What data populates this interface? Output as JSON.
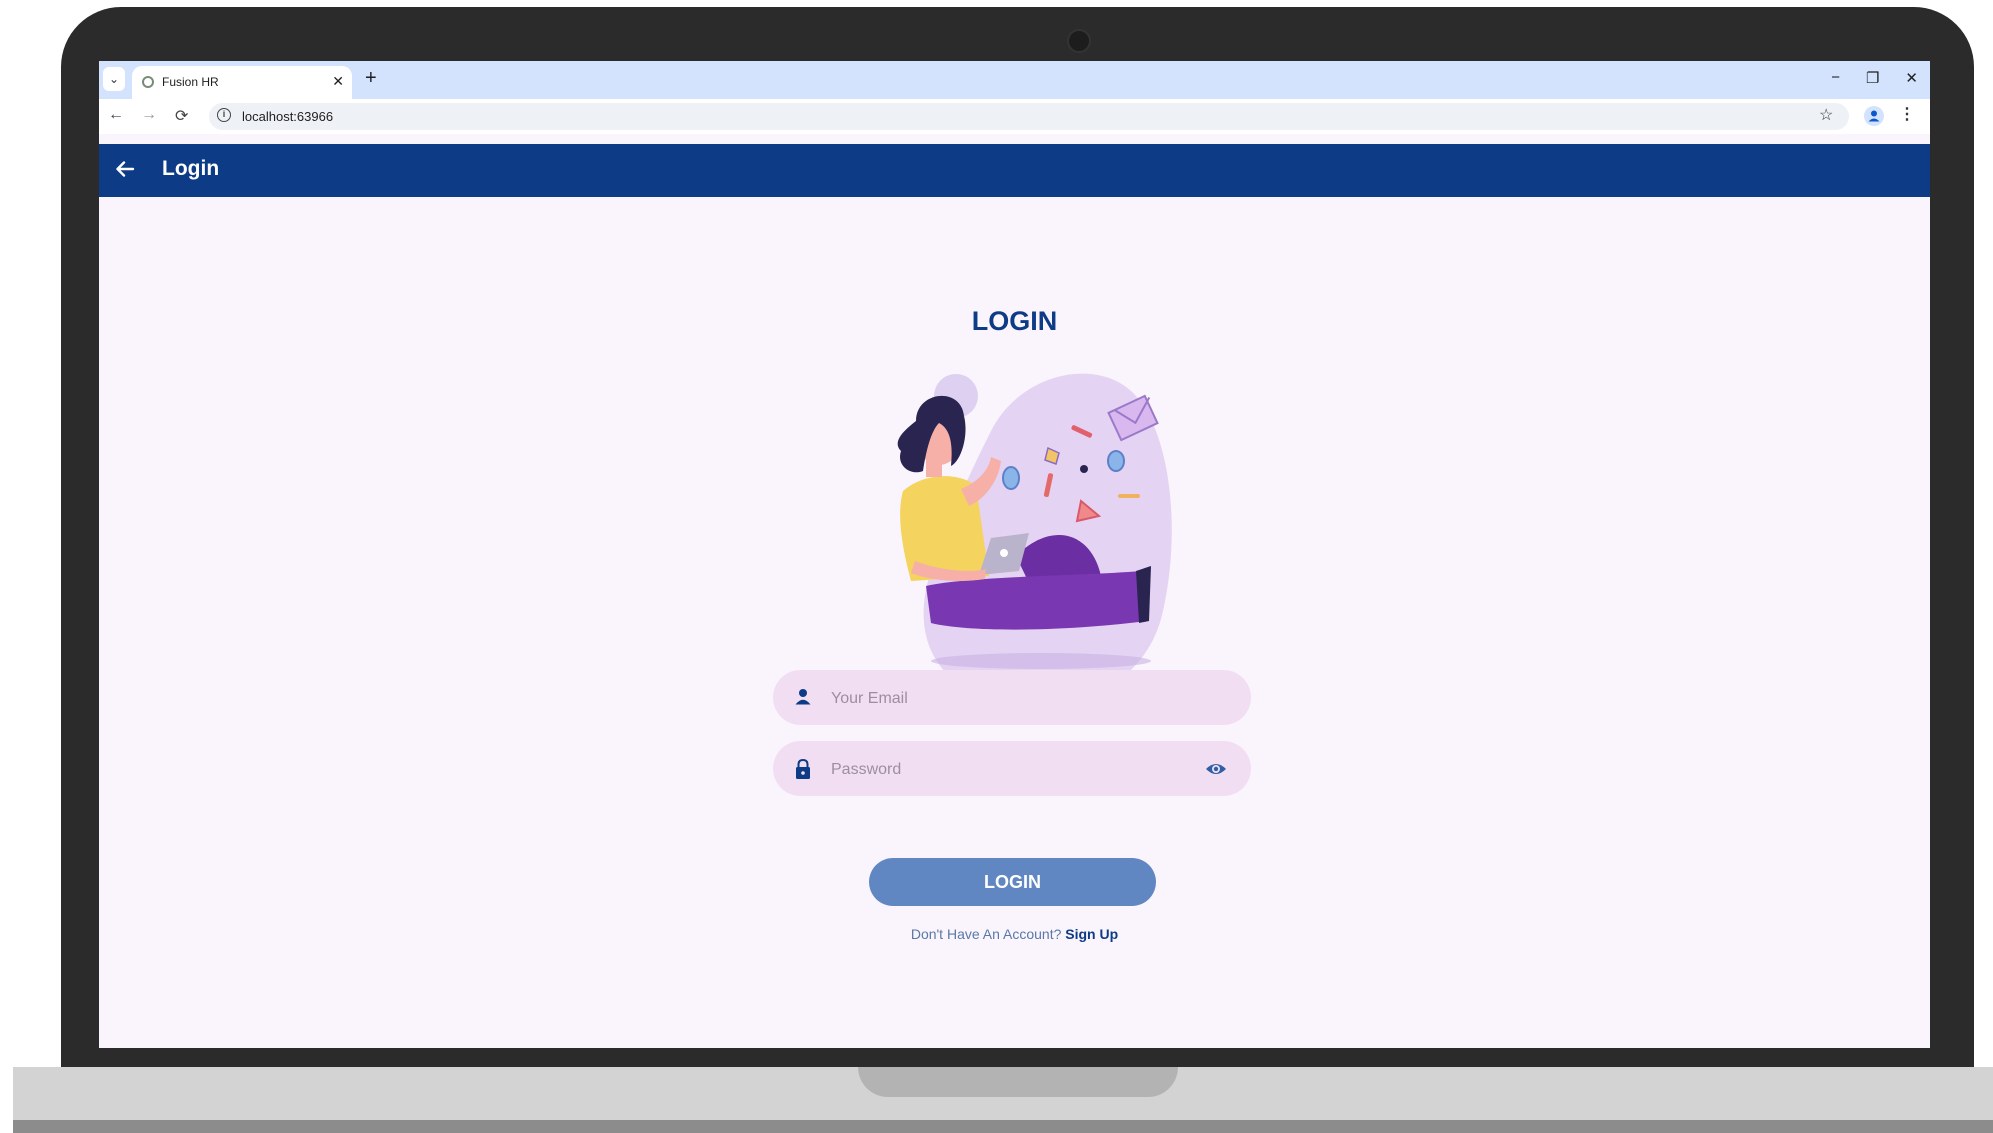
{
  "browser": {
    "tab_title": "Fusion HR",
    "tab_close": "✕",
    "new_tab": "+",
    "tab_menu": "⌄",
    "url": "localhost:63966",
    "back": "←",
    "forward": "→",
    "reload": "⟳",
    "info": "i",
    "star": "☆",
    "kebab": "⋮",
    "minimize": "−",
    "restore": "❐",
    "close": "✕"
  },
  "appbar": {
    "title": "Login"
  },
  "login": {
    "heading": "LOGIN",
    "email_placeholder": "Your Email",
    "password_placeholder": "Password",
    "button_label": "LOGIN",
    "no_account_text": "Don't Have An Account? ",
    "signup_label": "Sign Up"
  },
  "colors": {
    "primary": "#0e3b86",
    "button": "#6087c2",
    "field_bg": "#f1def3",
    "page_bg": "#faf5fc"
  }
}
